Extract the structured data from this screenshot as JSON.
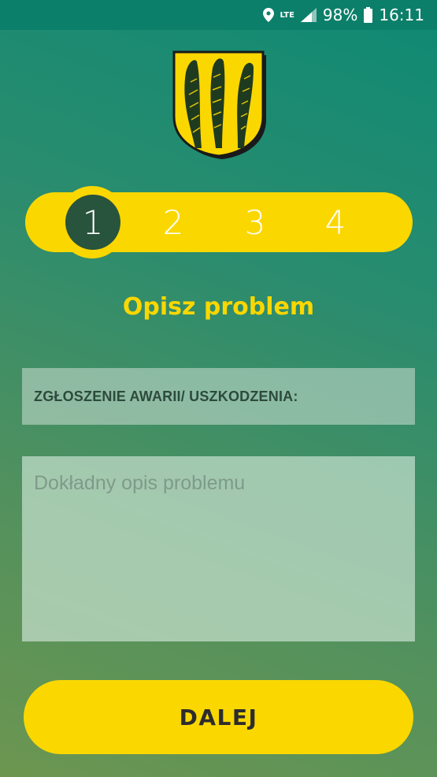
{
  "status_bar": {
    "network": "LTE",
    "battery": "98%",
    "time": "16:11",
    "icons": [
      "location-icon",
      "signal-icon",
      "battery-icon"
    ]
  },
  "crest": {
    "icon": "coat-of-arms-icon",
    "colors": {
      "shield": "#fbd700",
      "plant": "#1f3b1f",
      "outline": "#1a1a1a"
    }
  },
  "stepper": {
    "steps": [
      "1",
      "2",
      "3",
      "4"
    ],
    "active": 1
  },
  "heading": "Opisz problem",
  "form": {
    "category_label": "ZGŁOSZENIE AWARII/ USZKODZENIA:",
    "description_placeholder": "Dokładny opis problemu"
  },
  "next_button": "DALEJ",
  "colors": {
    "accent": "#fbd700",
    "active_step": "#28533c",
    "status_bar": "#0b7f6a"
  }
}
